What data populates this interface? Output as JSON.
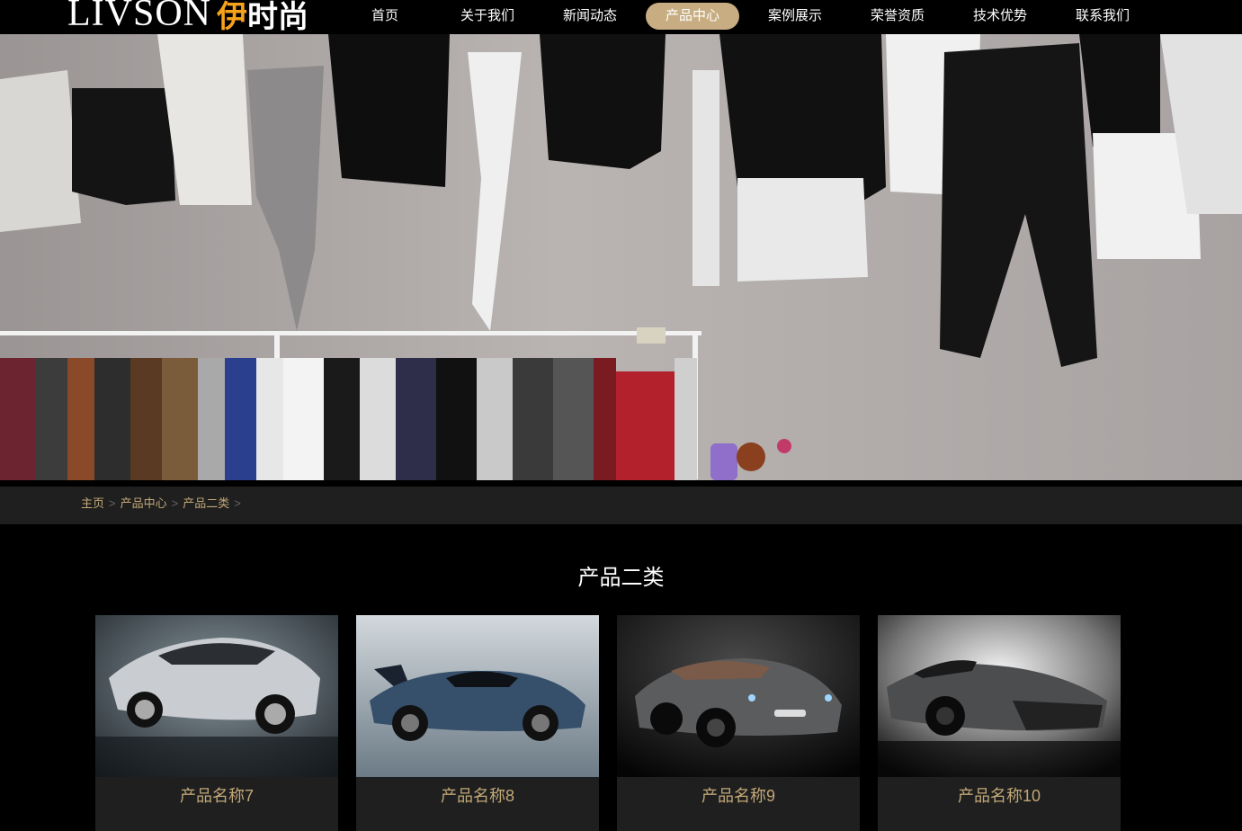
{
  "header": {
    "logo_text": "LIVSON",
    "logo_cn_first": "伊",
    "logo_cn_rest": "时尚",
    "nav": [
      {
        "label": "首页",
        "active": false
      },
      {
        "label": "关于我们",
        "active": false
      },
      {
        "label": "新闻动态",
        "active": false
      },
      {
        "label": "产品中心",
        "active": true
      },
      {
        "label": "案例展示",
        "active": false
      },
      {
        "label": "荣誉资质",
        "active": false
      },
      {
        "label": "技术优势",
        "active": false
      },
      {
        "label": "联系我们",
        "active": false
      }
    ]
  },
  "breadcrumb": {
    "items": [
      "主页",
      "产品中心",
      "产品二类"
    ],
    "separator": ">"
  },
  "section": {
    "title": "产品二类"
  },
  "products": [
    {
      "name": "产品名称7"
    },
    {
      "name": "产品名称8"
    },
    {
      "name": "产品名称9"
    },
    {
      "name": "产品名称10"
    }
  ],
  "colors": {
    "accent": "#c7ad81",
    "logo_orange": "#f7a21b",
    "breadcrumb_text": "#c2a877",
    "background": "#000000",
    "card_background": "#1f1f1f"
  }
}
